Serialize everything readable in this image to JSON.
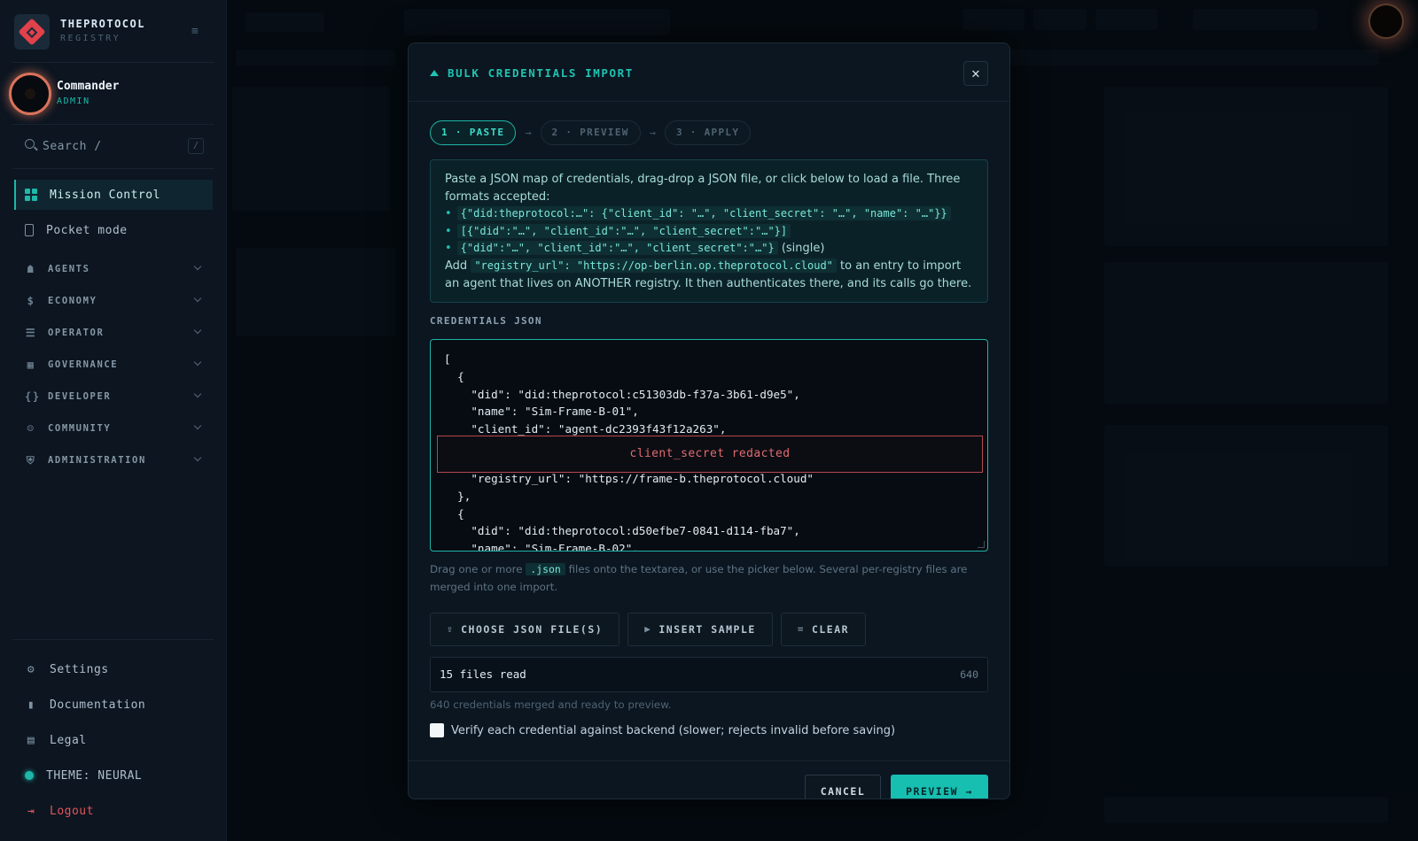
{
  "brand": {
    "name": "THEPROTOCOL",
    "subtitle": "REGISTRY"
  },
  "user": {
    "name": "Commander",
    "role": "ADMIN"
  },
  "search": {
    "placeholder": "Search  /",
    "shortcut": "/"
  },
  "nav": {
    "primary": [
      {
        "label": "Mission Control",
        "icon": "grid-icon",
        "active": true
      },
      {
        "label": "Pocket mode",
        "icon": "phone-icon",
        "active": false
      }
    ],
    "sections": [
      {
        "label": "AGENTS",
        "icon": "robot-icon"
      },
      {
        "label": "ECONOMY",
        "icon": "dollar-icon"
      },
      {
        "label": "OPERATOR",
        "icon": "server-icon"
      },
      {
        "label": "GOVERNANCE",
        "icon": "building-icon"
      },
      {
        "label": "DEVELOPER",
        "icon": "braces-icon"
      },
      {
        "label": "COMMUNITY",
        "icon": "people-icon"
      },
      {
        "label": "ADMINISTRATION",
        "icon": "shield-icon"
      }
    ],
    "footer": [
      {
        "label": "Settings",
        "icon": "gear-icon"
      },
      {
        "label": "Documentation",
        "icon": "book-icon"
      },
      {
        "label": "Legal",
        "icon": "document-icon"
      },
      {
        "label": "THEME: NEURAL",
        "icon": "theme-dot-icon"
      },
      {
        "label": "Logout",
        "icon": "logout-icon"
      }
    ]
  },
  "modal": {
    "title": "BULK CREDENTIALS IMPORT",
    "close_icon": "close-icon",
    "steps": [
      {
        "label": "1 · PASTE",
        "active": true
      },
      {
        "label": "2 · PREVIEW",
        "active": false
      },
      {
        "label": "3 · APPLY",
        "active": false
      }
    ],
    "step_separator": "→",
    "info": {
      "intro": "Paste a JSON map of credentials, drag-drop a JSON file, or click below to load a file. Three formats accepted:",
      "formats": [
        "{\"did:theprotocol:…\": {\"client_id\": \"…\", \"client_secret\": \"…\", \"name\": \"…\"}}",
        "[{\"did\":\"…\", \"client_id\":\"…\", \"client_secret\":\"…\"}]",
        "{\"did\":\"…\", \"client_id\":\"…\", \"client_secret\":\"…\"}"
      ],
      "format_3_suffix": "(single)",
      "registry_prefix": "Add",
      "registry_code": "\"registry_url\": \"https://op-berlin.op.theprotocol.cloud\"",
      "registry_suffix": "to an entry to import an agent that lives on ANOTHER registry. It then authenticates there, and its calls go there."
    },
    "credentials_label": "CREDENTIALS JSON",
    "editor": {
      "lines_before": "[\n  {\n    \"did\": \"did:theprotocol:c51303db-f37a-3b61-d9e5\",\n    \"name\": \"Sim-Frame-B-01\",\n    \"client_id\": \"agent-dc2393f43f12a263\",",
      "redacted_label": "client_secret redacted",
      "lines_after": "    \"registry_url\": \"https://frame-b.theprotocol.cloud\"\n  },\n  {\n    \"did\": \"did:theprotocol:d50efbe7-0841-d114-fba7\",\n    \"name\": \"Sim-Frame-B-02\","
    },
    "hint": {
      "prefix": "Drag one or more",
      "code": ".json",
      "suffix": "files onto the textarea, or use the picker below. Several per-registry files are merged into one import."
    },
    "buttons": {
      "choose": "CHOOSE JSON FILE(S)",
      "insert": "INSERT SAMPLE",
      "clear": "CLEAR"
    },
    "status": {
      "text": "15 files read",
      "count": "640"
    },
    "merged_text": "640 credentials merged and ready to preview.",
    "verify_label": "Verify each credential against backend (slower; rejects invalid before saving)",
    "verify_checked": false,
    "footer": {
      "cancel": "CANCEL",
      "preview": "PREVIEW →"
    }
  }
}
